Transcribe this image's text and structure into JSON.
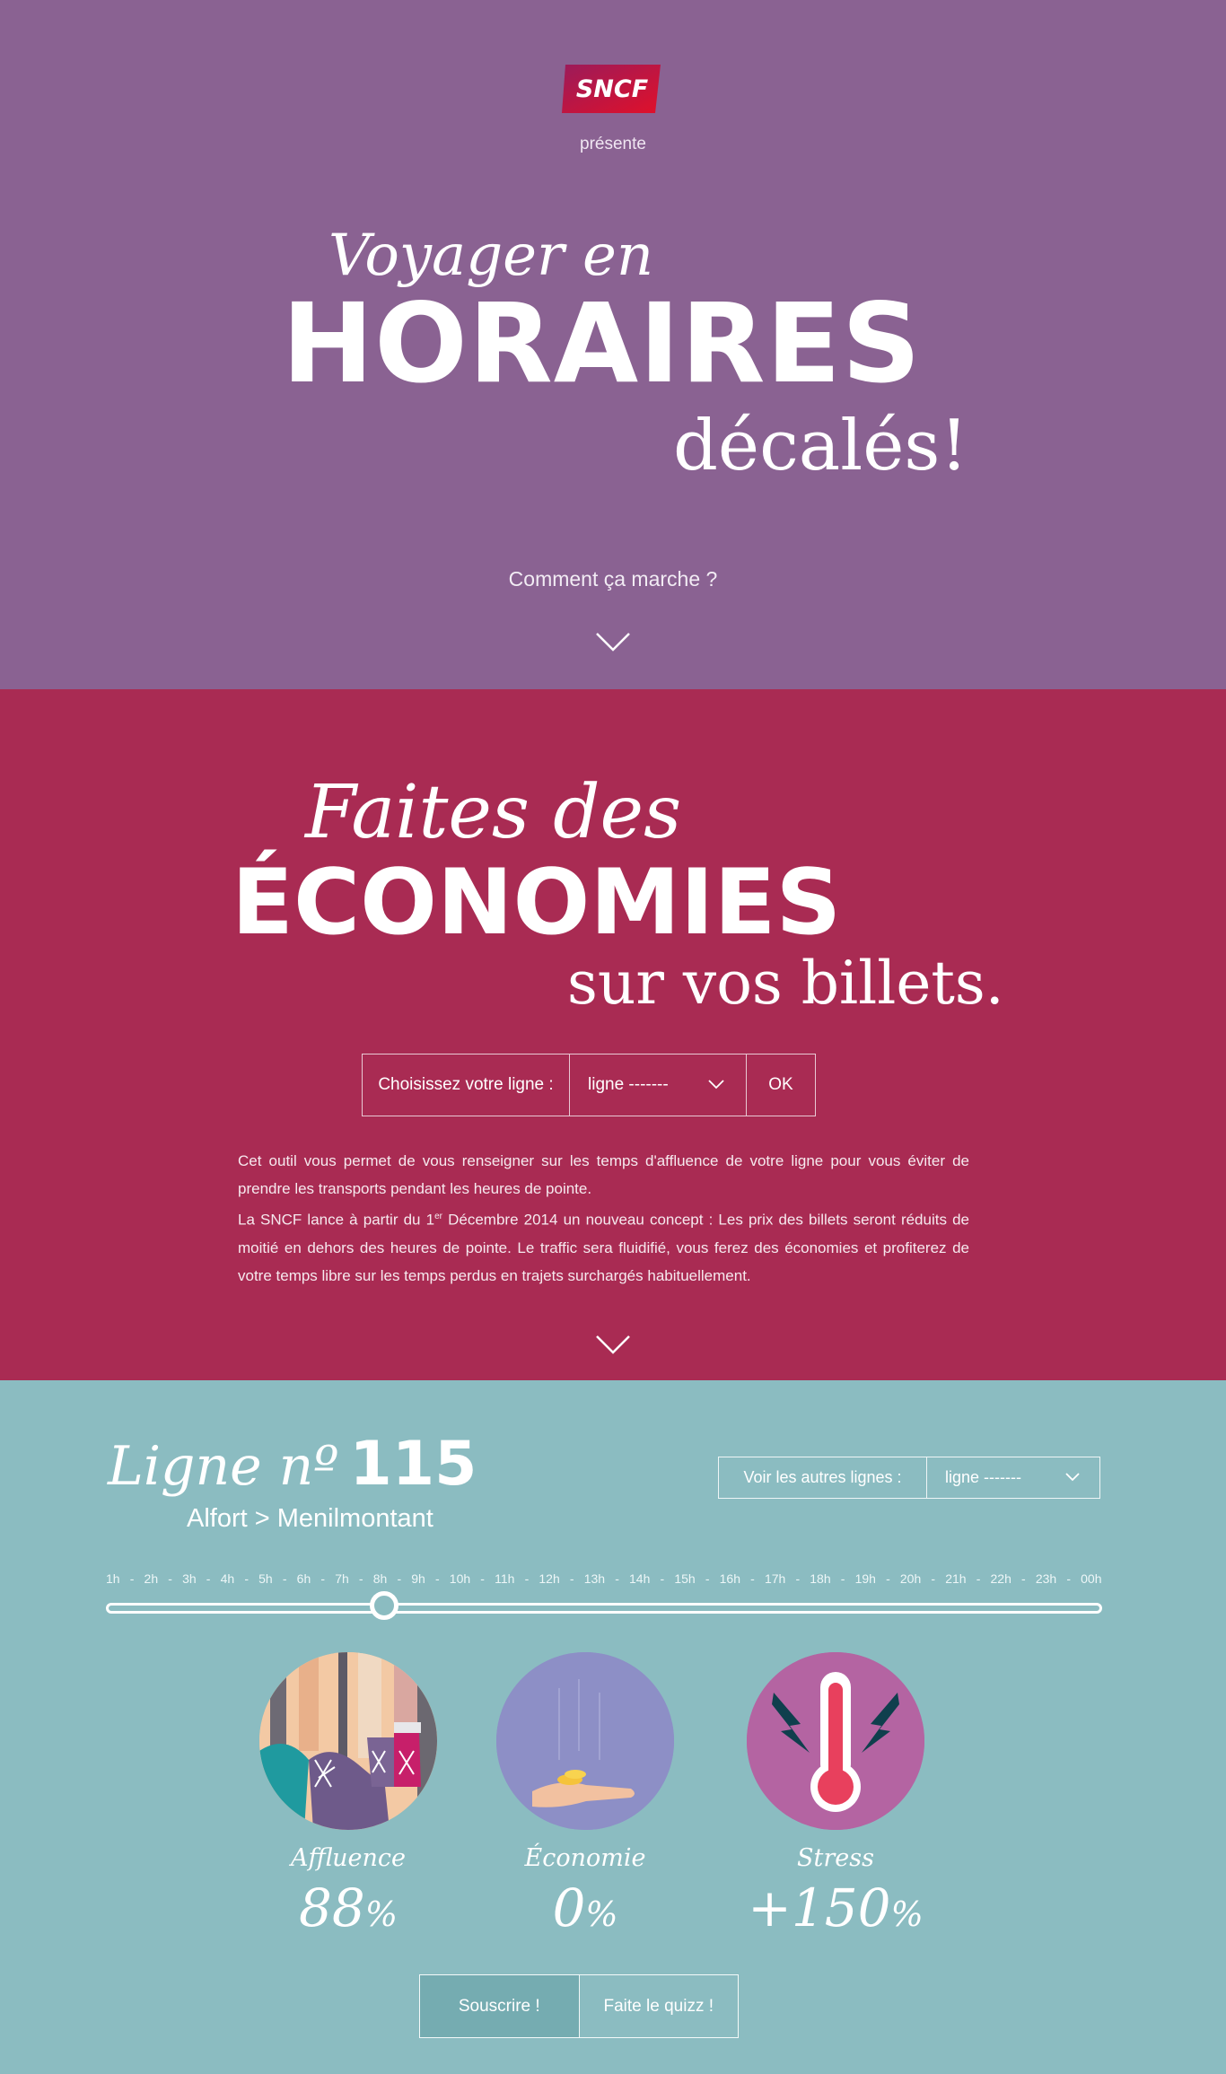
{
  "hero": {
    "logo_text": "SNCF",
    "presente": "présente",
    "title_line1": "Voyager en",
    "title_line2": "HORAIRES",
    "title_line3": "décalés!",
    "how_link": "Comment ça marche ?"
  },
  "savings": {
    "title_line1": "Faites des",
    "title_line2": "ÉCONOMIES",
    "title_line3": "sur vos billets.",
    "form_label": "Choisissez votre ligne :",
    "select_value": "ligne -------",
    "ok_label": "OK",
    "desc_p1": "Cet outil vous permet de vous renseigner sur les temps d'affluence de votre ligne pour vous éviter de prendre les transports pendant les heures de pointe.",
    "desc_p2_a": "La SNCF lance à partir du 1",
    "desc_p2_sup": "er",
    "desc_p2_b": " Décembre 2014 un nouveau concept : Les prix des billets seront réduits de moitié en dehors des heures de pointe. Le traffic sera fluidifié, vous ferez des économies et profiterez de votre temps libre sur les temps perdus en trajets surchargés habituellement."
  },
  "line": {
    "prefix": "Ligne nº",
    "number": "115",
    "route": "Alfort > Menilmontant",
    "other_label": "Voir les autres lignes :",
    "other_select": "ligne -------",
    "hours": [
      "1h",
      "2h",
      "3h",
      "4h",
      "5h",
      "6h",
      "7h",
      "8h",
      "9h",
      "10h",
      "11h",
      "12h",
      "13h",
      "14h",
      "15h",
      "16h",
      "17h",
      "18h",
      "19h",
      "20h",
      "21h",
      "22h",
      "23h",
      "00h"
    ],
    "selected_hour": "8h"
  },
  "stats": [
    {
      "label": "Affluence",
      "value": "88",
      "unit": "%"
    },
    {
      "label": "Économie",
      "value": "0",
      "unit": "%"
    },
    {
      "label": "Stress",
      "value": "+150",
      "unit": "%"
    }
  ],
  "actions": {
    "subscribe": "Souscrire !",
    "quiz": "Faite le quizz !"
  },
  "colors": {
    "hero_bg": "#8a6292",
    "savings_bg": "#a92b53",
    "line_bg": "#8bbcc1",
    "logo_red": "#c8102e"
  }
}
